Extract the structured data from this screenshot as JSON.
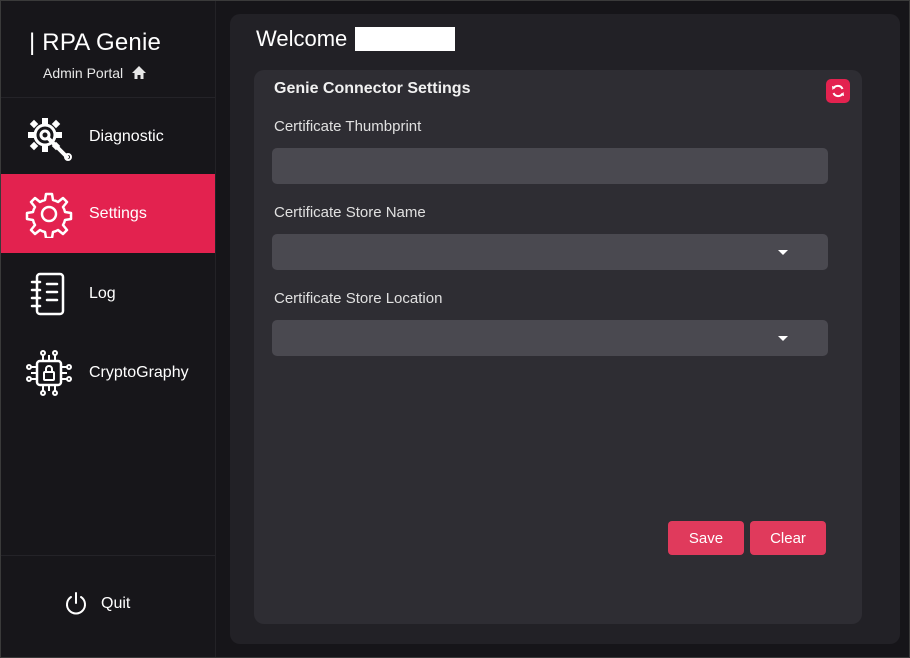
{
  "sidebar": {
    "brand_title": "| RPA Genie",
    "brand_subtitle": "Admin Portal",
    "items": [
      {
        "label": "Diagnostic",
        "icon": "gear-wrench-icon"
      },
      {
        "label": "Settings",
        "icon": "gear-icon",
        "active": true
      },
      {
        "label": "Log",
        "icon": "notebook-icon"
      },
      {
        "label": "CryptoGraphy",
        "icon": "chip-lock-icon"
      }
    ],
    "quit_label": "Quit"
  },
  "header": {
    "welcome": "Welcome"
  },
  "card": {
    "title": "Genie Connector Settings",
    "fields": {
      "thumbprint_label": "Certificate Thumbprint",
      "thumbprint_value": "",
      "store_name_label": "Certificate Store Name",
      "store_name_value": "",
      "store_location_label": "Certificate Store Location",
      "store_location_value": ""
    },
    "save_label": "Save",
    "clear_label": "Clear"
  },
  "colors": {
    "accent": "#e3224f",
    "button": "#e03a5c",
    "background": "#161519",
    "panel": "#222126",
    "card": "#2e2d33",
    "field": "#4a4950"
  }
}
